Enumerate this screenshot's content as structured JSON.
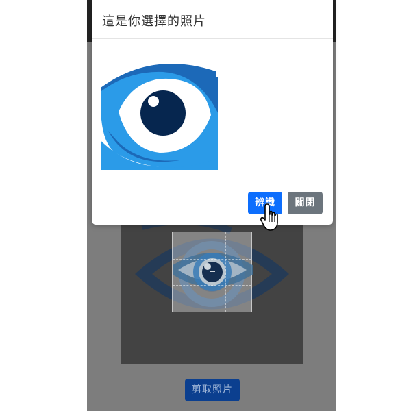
{
  "modal": {
    "title": "這是你選擇的照片",
    "recognize_label": "辨識",
    "close_label": "關閉"
  },
  "page": {
    "crop_label": "剪取照片"
  },
  "colors": {
    "primary": "#0d6efd",
    "secondary": "#6c757d",
    "eye_light": "#2b9be8",
    "eye_dark": "#1c69b8",
    "pupil": "#06264f"
  },
  "icons": {
    "preview": "eye-logo-image",
    "cursor": "hand-pointer-icon"
  }
}
